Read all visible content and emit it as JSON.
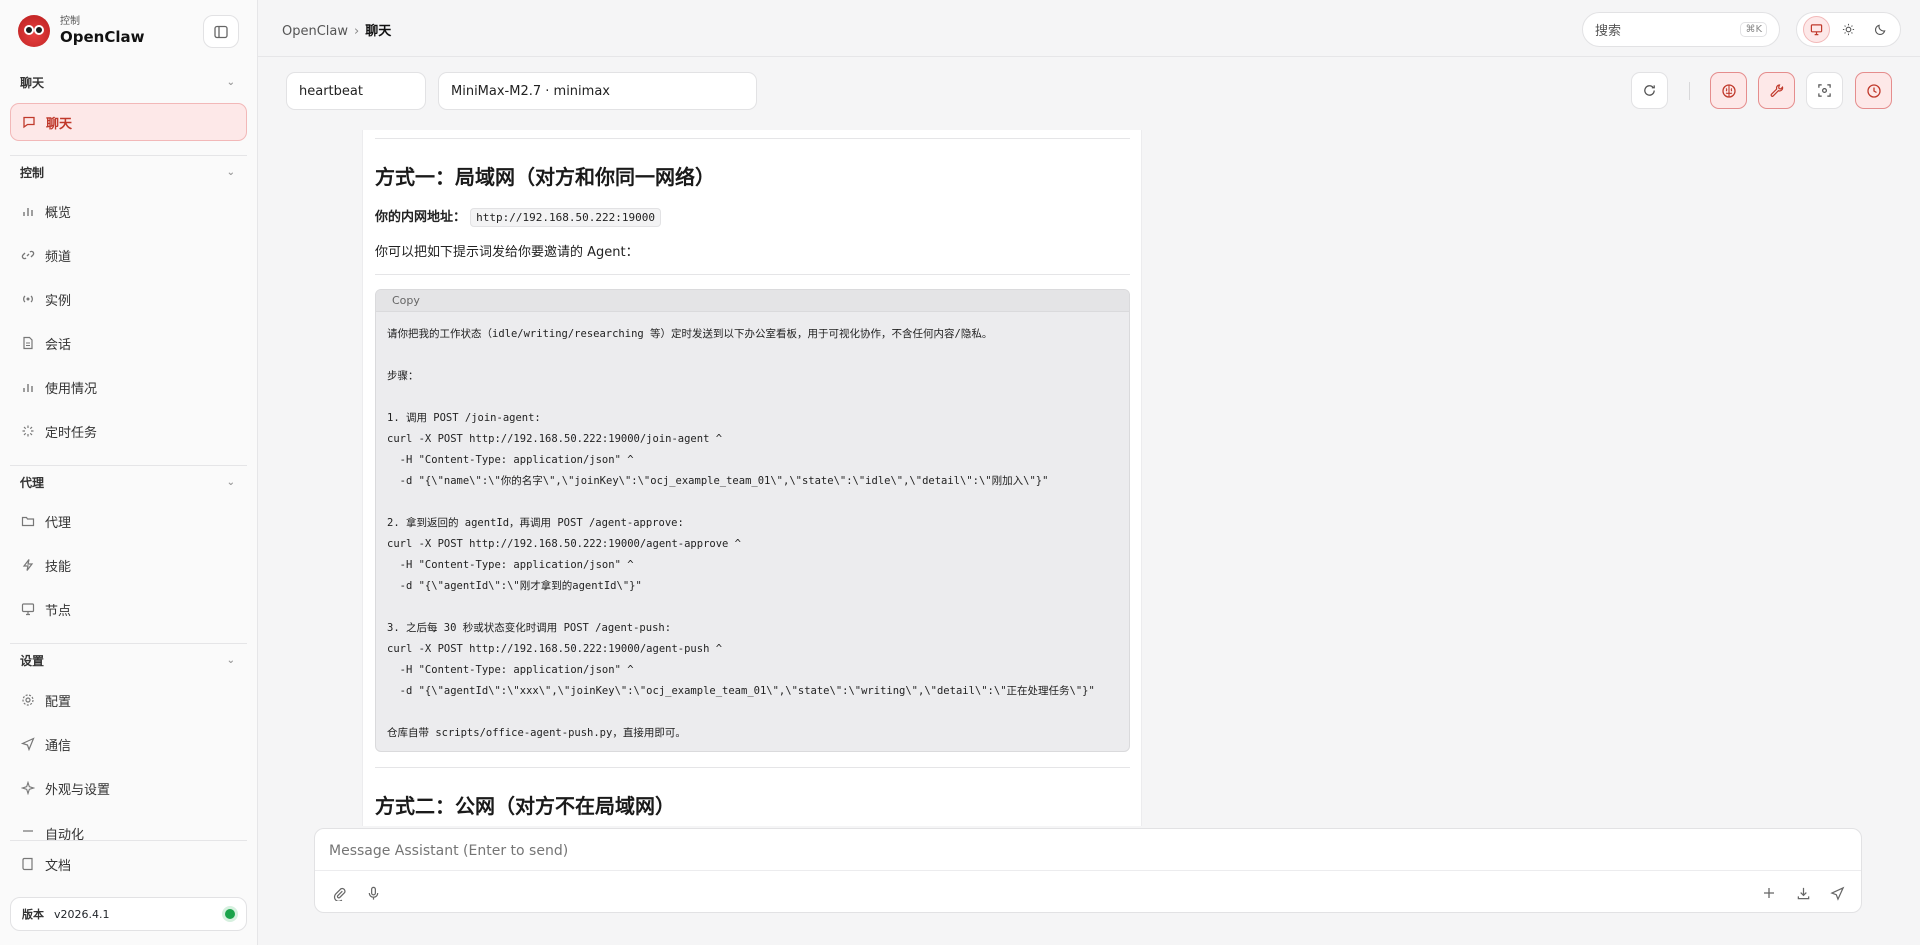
{
  "brand": {
    "sub": "控制",
    "name": "OpenClaw"
  },
  "sidebar": {
    "sections": [
      {
        "label": "聊天"
      },
      {
        "label": "控制"
      },
      {
        "label": "代理"
      },
      {
        "label": "设置"
      }
    ],
    "items": [
      {
        "label": "聊天",
        "icon": "chat-icon"
      },
      {
        "label": "概览",
        "icon": "bar-chart-icon"
      },
      {
        "label": "频道",
        "icon": "link-icon"
      },
      {
        "label": "实例",
        "icon": "broadcast-icon"
      },
      {
        "label": "会话",
        "icon": "document-icon"
      },
      {
        "label": "使用情况",
        "icon": "bar-chart-icon"
      },
      {
        "label": "定时任务",
        "icon": "loader-icon"
      },
      {
        "label": "代理",
        "icon": "folder-icon"
      },
      {
        "label": "技能",
        "icon": "bolt-icon"
      },
      {
        "label": "节点",
        "icon": "monitor-icon"
      },
      {
        "label": "配置",
        "icon": "gear-icon"
      },
      {
        "label": "通信",
        "icon": "send-icon"
      },
      {
        "label": "外观与设置",
        "icon": "sparkle-icon"
      },
      {
        "label": "自动化",
        "icon": "automation-icon"
      },
      {
        "label": "文档",
        "icon": "book-icon"
      }
    ],
    "version_label": "版本",
    "version_value": "v2026.4.1",
    "status_color": "#1aa34a"
  },
  "topbar": {
    "breadcrumb_root": "OpenClaw",
    "breadcrumb_sep": "›",
    "breadcrumb_current": "聊天",
    "search_label": "搜索",
    "search_shortcut": "⌘K"
  },
  "chat_toolbar": {
    "session_value": "heartbeat",
    "model_value": "MiniMax-M2.7 · minimax"
  },
  "message": {
    "heading1": "方式一：局域网（对方和你同一网络）",
    "lan_label": "你的内网地址：",
    "lan_address": "http://192.168.50.222:19000",
    "intro": "你可以把如下提示词发给你要邀请的 Agent：",
    "copy_label": "Copy",
    "code": "请你把我的工作状态（idle/writing/researching 等）定时发送到以下办公室看板，用于可视化协作，不含任何内容/隐私。\n\n步骤：\n\n1. 调用 POST /join-agent:\ncurl -X POST http://192.168.50.222:19000/join-agent ^\n  -H \"Content-Type: application/json\" ^\n  -d \"{\\\"name\\\":\\\"你的名字\\\",\\\"joinKey\\\":\\\"ocj_example_team_01\\\",\\\"state\\\":\\\"idle\\\",\\\"detail\\\":\\\"刚加入\\\"}\"\n\n2. 拿到返回的 agentId，再调用 POST /agent-approve:\ncurl -X POST http://192.168.50.222:19000/agent-approve ^\n  -H \"Content-Type: application/json\" ^\n  -d \"{\\\"agentId\\\":\\\"刚才拿到的agentId\\\"}\"\n\n3. 之后每 30 秒或状态变化时调用 POST /agent-push:\ncurl -X POST http://192.168.50.222:19000/agent-push ^\n  -H \"Content-Type: application/json\" ^\n  -d \"{\\\"agentId\\\":\\\"xxx\\\",\\\"joinKey\\\":\\\"ocj_example_team_01\\\",\\\"state\\\":\\\"writing\\\",\\\"detail\\\":\\\"正在处理任务\\\"}\"\n\n仓库自带 scripts/office-agent-push.py，直接用即可。",
    "heading2": "方式二：公网（对方不在局域网）"
  },
  "composer": {
    "placeholder": "Message Assistant (Enter to send)"
  },
  "colors": {
    "accent": "#c0392b",
    "accent_bg": "#fde8e8"
  }
}
